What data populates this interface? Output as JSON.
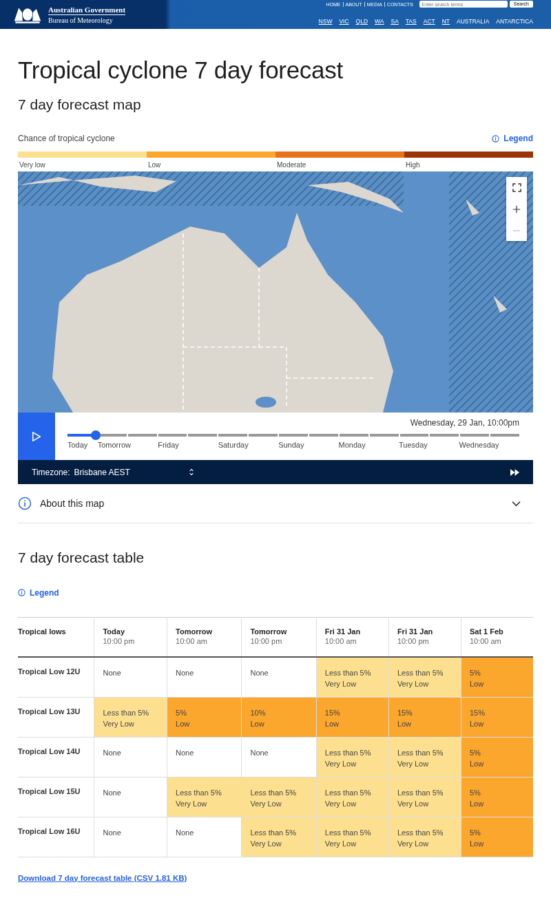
{
  "header": {
    "gov": "Australian Government",
    "agency": "Bureau of Meteorology",
    "top_links": [
      "HOME",
      "ABOUT",
      "MEDIA",
      "CONTACTS"
    ],
    "search": {
      "placeholder": "Enter search terms",
      "button": "Search"
    },
    "states": [
      {
        "label": "NSW",
        "underlined": true
      },
      {
        "label": "VIC",
        "underlined": true
      },
      {
        "label": "QLD",
        "underlined": true
      },
      {
        "label": "WA",
        "underlined": true
      },
      {
        "label": "SA",
        "underlined": true
      },
      {
        "label": "TAS",
        "underlined": true
      },
      {
        "label": "ACT",
        "underlined": true
      },
      {
        "label": "NT",
        "underlined": true
      },
      {
        "label": "AUSTRALIA",
        "underlined": false
      },
      {
        "label": "ANTARCTICA",
        "underlined": false
      }
    ]
  },
  "title": "Tropical cyclone 7 day forecast",
  "map_section": {
    "heading": "7 day forecast map",
    "scale_title": "Chance of tropical cyclone",
    "legend_link": "Legend",
    "scale": [
      {
        "label": "Very low",
        "color": "#fde08f"
      },
      {
        "label": "Low",
        "color": "#fba62d"
      },
      {
        "label": "Moderate",
        "color": "#e9711a"
      },
      {
        "label": "High",
        "color": "#9b3507"
      }
    ],
    "timeline": {
      "date": "Wednesday, 29 Jan, 10:00pm",
      "level": 0.04,
      "days": [
        "Today",
        "Tomorrow",
        "Friday",
        "Saturday",
        "Sunday",
        "Monday",
        "Tuesday",
        "Wednesday"
      ]
    },
    "timezone": {
      "label": "Timezone:",
      "value": "Brisbane AEST"
    },
    "about": {
      "label": "About this map",
      "expanded": false
    }
  },
  "table_section": {
    "heading": "7 day forecast table",
    "legend_link": "Legend",
    "corner": "Tropical lows",
    "columns": [
      {
        "day": "Today",
        "time": "10:00 pm"
      },
      {
        "day": "Tomorrow",
        "time": "10:00 am"
      },
      {
        "day": "Tomorrow",
        "time": "10:00 pm"
      },
      {
        "day": "Fri 31 Jan",
        "time": "10:00 am"
      },
      {
        "day": "Fri 31 Jan",
        "time": "10:00 pm"
      },
      {
        "day": "Sat 1 Feb",
        "time": "10:00 am"
      }
    ],
    "rows": [
      {
        "name": "Tropical Low 12U",
        "cells": [
          {
            "kind": "none",
            "chance": "None"
          },
          {
            "kind": "none",
            "chance": "None"
          },
          {
            "kind": "none",
            "chance": "None"
          },
          {
            "kind": "very_low",
            "chance": "Less than 5%",
            "category": "Very Low"
          },
          {
            "kind": "very_low",
            "chance": "Less than 5%",
            "category": "Very Low"
          },
          {
            "kind": "low",
            "chance": "5%",
            "category": "Low"
          }
        ]
      },
      {
        "name": "Tropical Low 13U",
        "cells": [
          {
            "kind": "very_low",
            "chance": "Less than 5%",
            "category": "Very Low"
          },
          {
            "kind": "low",
            "chance": "5%",
            "category": "Low"
          },
          {
            "kind": "low",
            "chance": "10%",
            "category": "Low"
          },
          {
            "kind": "low",
            "chance": "15%",
            "category": "Low"
          },
          {
            "kind": "low",
            "chance": "15%",
            "category": "Low"
          },
          {
            "kind": "low",
            "chance": "15%",
            "category": "Low"
          }
        ]
      },
      {
        "name": "Tropical Low 14U",
        "cells": [
          {
            "kind": "none",
            "chance": "None"
          },
          {
            "kind": "none",
            "chance": "None"
          },
          {
            "kind": "none",
            "chance": "None"
          },
          {
            "kind": "very_low",
            "chance": "Less than 5%",
            "category": "Very Low"
          },
          {
            "kind": "very_low",
            "chance": "Less than 5%",
            "category": "Very Low"
          },
          {
            "kind": "low",
            "chance": "5%",
            "category": "Low"
          }
        ]
      },
      {
        "name": "Tropical Low 15U",
        "cells": [
          {
            "kind": "none",
            "chance": "None"
          },
          {
            "kind": "very_low",
            "chance": "Less than 5%",
            "category": "Very Low"
          },
          {
            "kind": "very_low",
            "chance": "Less than 5%",
            "category": "Very Low"
          },
          {
            "kind": "very_low",
            "chance": "Less than 5%",
            "category": "Very Low"
          },
          {
            "kind": "very_low",
            "chance": "Less than 5%",
            "category": "Very Low"
          },
          {
            "kind": "low",
            "chance": "5%",
            "category": "Low"
          }
        ]
      },
      {
        "name": "Tropical Low 16U",
        "cells": [
          {
            "kind": "none",
            "chance": "None"
          },
          {
            "kind": "none",
            "chance": "None"
          },
          {
            "kind": "very_low",
            "chance": "Less than 5%",
            "category": "Very Low"
          },
          {
            "kind": "very_low",
            "chance": "Less than 5%",
            "category": "Very Low"
          },
          {
            "kind": "very_low",
            "chance": "Less than 5%",
            "category": "Very Low"
          },
          {
            "kind": "low",
            "chance": "5%",
            "category": "Low"
          }
        ]
      }
    ],
    "download": "Download 7 day forecast table (CSV 1.81 KB)"
  }
}
